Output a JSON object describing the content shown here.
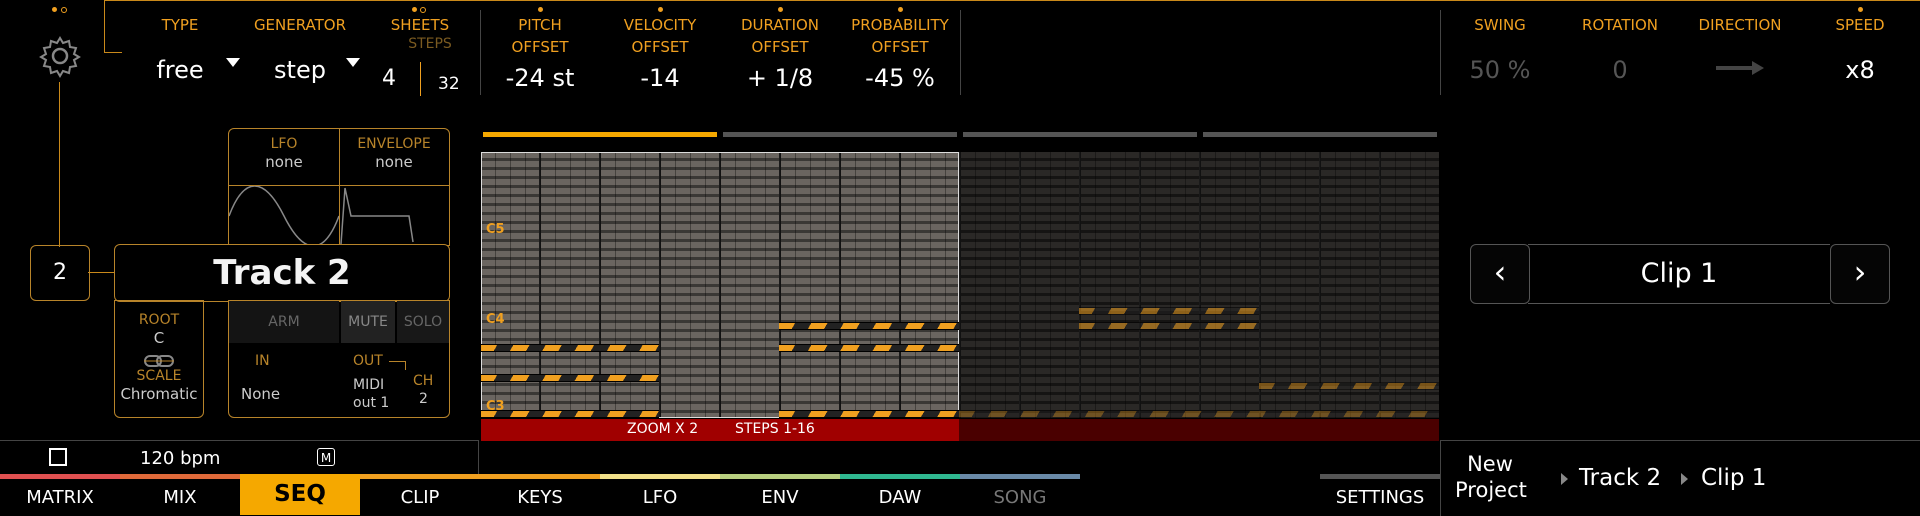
{
  "colors": {
    "accent": "#F0A020",
    "active_tab": "#F5A800",
    "zoom_bar": "#A00000",
    "zoom_bar_dim": "#4A0000"
  },
  "header": {
    "type": {
      "label": "TYPE",
      "value": "free"
    },
    "generator": {
      "label": "GENERATOR",
      "value": "step"
    },
    "sheets": {
      "label": "SHEETS",
      "sub": "STEPS",
      "value": "4",
      "steps": "32"
    },
    "pitch": {
      "label1": "PITCH",
      "label2": "OFFSET",
      "value": "-24 st"
    },
    "velocity": {
      "label1": "VELOCITY",
      "label2": "OFFSET",
      "value": "-14"
    },
    "duration": {
      "label1": "DURATION",
      "label2": "OFFSET",
      "value": "+ 1/8"
    },
    "probability": {
      "label1": "PROBABILITY",
      "label2": "OFFSET",
      "value": "-45 %"
    },
    "swing": {
      "label": "SWING",
      "value": "50 %"
    },
    "rotation": {
      "label": "ROTATION",
      "value": "0"
    },
    "direction": {
      "label": "DIRECTION"
    },
    "speed": {
      "label": "SPEED",
      "value": "x8"
    }
  },
  "track": {
    "number": "2",
    "name": "Track 2",
    "lfo": {
      "label": "LFO",
      "value": "none"
    },
    "envelope": {
      "label": "ENVELOPE",
      "value": "none"
    },
    "root": {
      "label": "ROOT",
      "value": "C"
    },
    "scale": {
      "label": "SCALE",
      "value": "Chromatic"
    },
    "arm": "ARM",
    "mute": "MUTE",
    "solo": "SOLO",
    "in": {
      "label": "IN",
      "value": "None"
    },
    "out": {
      "label": "OUT",
      "value1": "MIDI",
      "value2": "out 1"
    },
    "ch": {
      "label": "CH",
      "value": "2"
    }
  },
  "grid": {
    "notes": [
      "C5",
      "C4",
      "C3"
    ],
    "zoom": "ZOOM X 2",
    "steps": "STEPS 1-16"
  },
  "clip": {
    "name": "Clip 1",
    "prev": "‹",
    "next": "›"
  },
  "transport": {
    "bpm": "120 bpm",
    "metronome": "M"
  },
  "tabs": [
    {
      "label": "MATRIX",
      "color": "#E05050"
    },
    {
      "label": "MIX",
      "color": "#E06A3A"
    },
    {
      "label": "SEQ",
      "color": "#F5A800"
    },
    {
      "label": "CLIP",
      "color": "#F0A020"
    },
    {
      "label": "KEYS",
      "color": "#F0A020"
    },
    {
      "label": "LFO",
      "color": "#F2E18A"
    },
    {
      "label": "ENV",
      "color": "#B8D080"
    },
    {
      "label": "DAW",
      "color": "#30B890"
    },
    {
      "label": "SONG",
      "color": "#6A8AA8"
    }
  ],
  "settings": "SETTINGS",
  "breadcrumb": {
    "project1": "New",
    "project2": "Project",
    "track": "Track 2",
    "clip": "Clip 1"
  }
}
